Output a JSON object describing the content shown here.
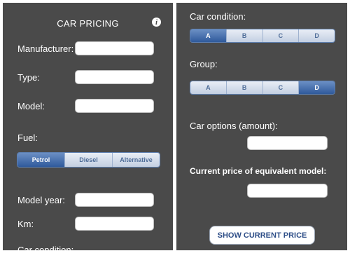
{
  "left": {
    "title": "CAR PRICING",
    "info_icon_glyph": "i",
    "manufacturer_label": "Manufacturer:",
    "type_label": "Type:",
    "model_label": "Model:",
    "fuel_label": "Fuel:",
    "fuel_options": [
      "Petrol",
      "Diesel",
      "Alternative"
    ],
    "fuel_selected": "Petrol",
    "model_year_label": "Model year:",
    "km_label": "Km:",
    "car_condition_label_cut": "Car condition:"
  },
  "right": {
    "car_condition_label": "Car condition:",
    "condition_options": [
      "A",
      "B",
      "C",
      "D"
    ],
    "condition_selected": "A",
    "group_label": "Group:",
    "group_options": [
      "A",
      "B",
      "C",
      "D"
    ],
    "group_selected": "D",
    "car_options_label": "Car options (amount):",
    "current_price_label": "Current price of equivalent model:",
    "show_price_button": "SHOW CURRENT PRICE"
  },
  "colors": {
    "background": "#4a4a4a",
    "segment_selected": "#2f5a9c",
    "segment_unselected": "#d6deeb",
    "button_text": "#2f4f88"
  }
}
